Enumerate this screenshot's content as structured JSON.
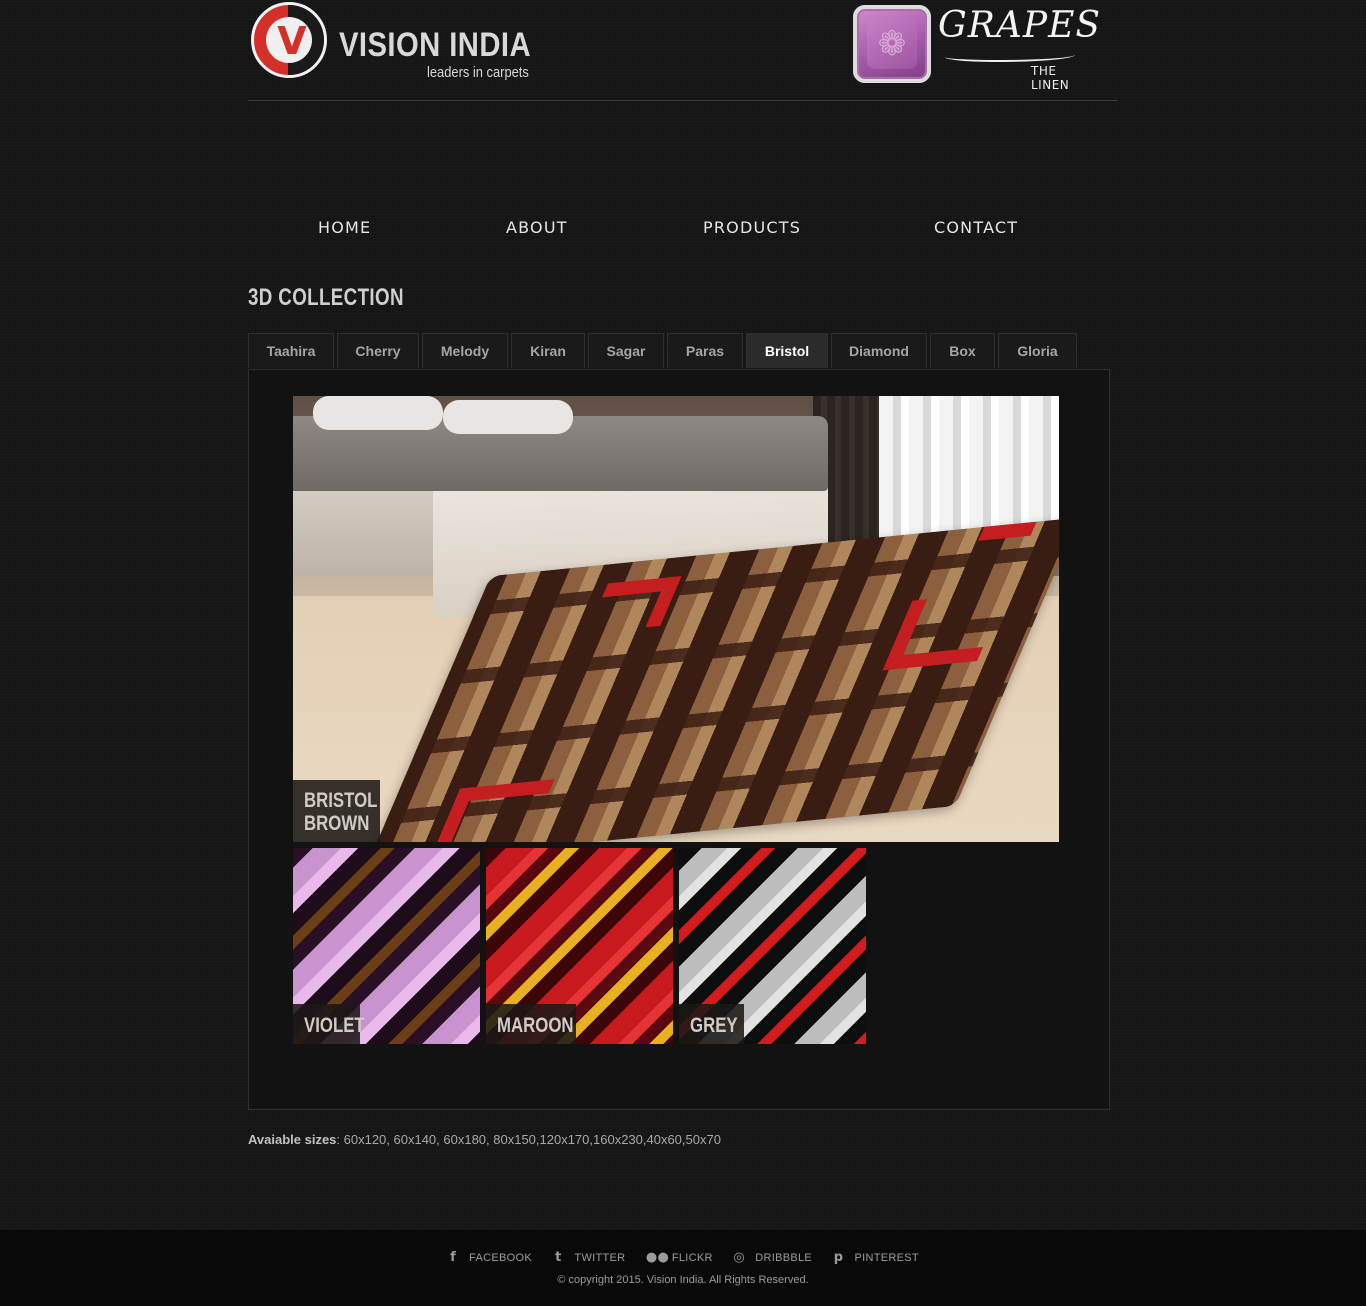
{
  "header": {
    "brand_name": "VISION INDIA",
    "brand_tagline": "leaders in carpets",
    "partner_name": "GRAPES",
    "partner_tagline": "THE LINEN"
  },
  "nav": {
    "items": [
      {
        "label": "HOME"
      },
      {
        "label": "ABOUT"
      },
      {
        "label": "PRODUCTS"
      },
      {
        "label": "CONTACT"
      }
    ]
  },
  "page": {
    "title": "3D COLLECTION",
    "tabs": [
      {
        "label": "Taahira"
      },
      {
        "label": "Cherry"
      },
      {
        "label": "Melody"
      },
      {
        "label": "Kiran"
      },
      {
        "label": "Sagar"
      },
      {
        "label": "Paras"
      },
      {
        "label": "Bristol",
        "active": true
      },
      {
        "label": "Diamond"
      },
      {
        "label": "Box"
      },
      {
        "label": "Gloria"
      }
    ],
    "main_product": {
      "caption_line1": "BRISTOL",
      "caption_line2": "BROWN"
    },
    "variants": [
      {
        "label": "VIOLET"
      },
      {
        "label": "MAROON"
      },
      {
        "label": "GREY"
      }
    ],
    "sizes_label": "Avaiable sizes",
    "sizes_value": ": 60x120, 60x140, 60x180, 80x150,120x170,160x230,40x60,50x70"
  },
  "footer": {
    "social": [
      {
        "label": "FACEBOOK",
        "icon": "facebook-icon"
      },
      {
        "label": "TWITTER",
        "icon": "twitter-icon"
      },
      {
        "label": "FLICKR",
        "icon": "flickr-icon"
      },
      {
        "label": "DRIBBBLE",
        "icon": "dribbble-icon"
      },
      {
        "label": "PINTEREST",
        "icon": "pinterest-icon"
      }
    ],
    "copyright": "© copyright 2015. Vision India. All Rights Reserved."
  },
  "colors": {
    "background": "#151515",
    "accent_red": "#d4302a",
    "grapes_purple": "#a45aa8",
    "footer_bg": "#090909"
  }
}
